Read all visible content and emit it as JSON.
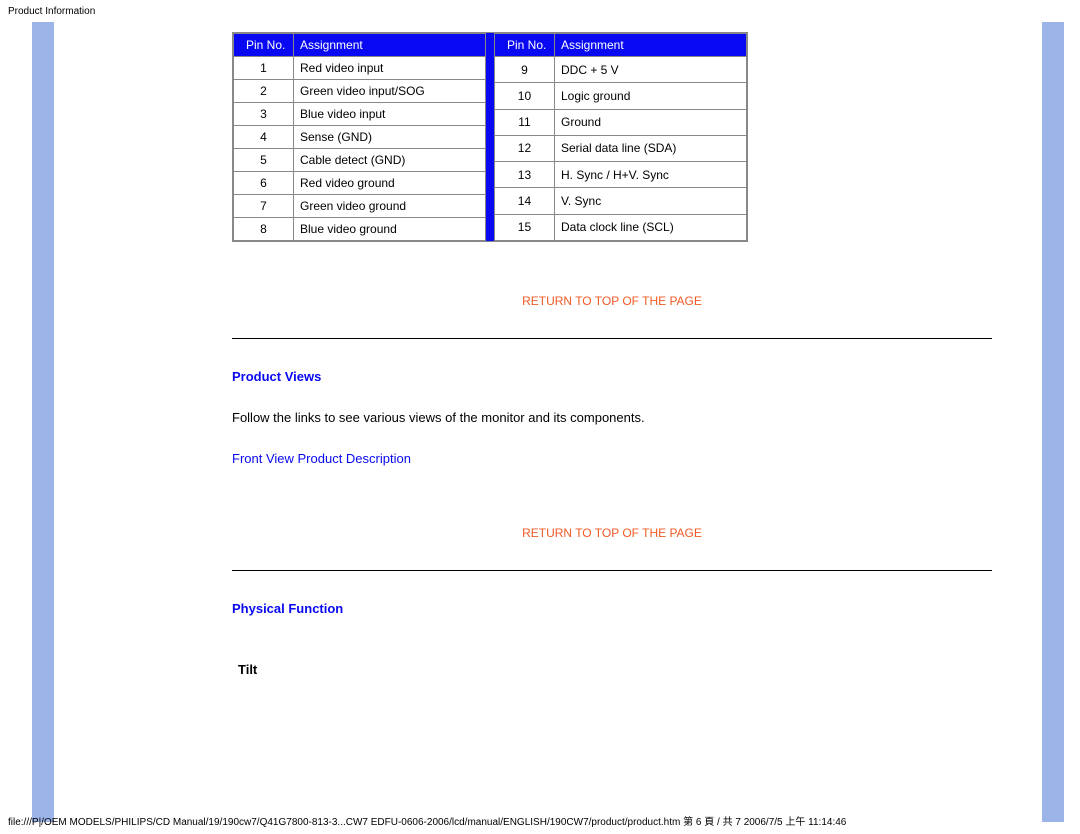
{
  "header_label": "Product Information",
  "table": {
    "headers": {
      "pin": "Pin No.",
      "assign": "Assignment"
    },
    "left": [
      {
        "pin": "1",
        "assign": "Red video input"
      },
      {
        "pin": "2",
        "assign": "Green video input/SOG"
      },
      {
        "pin": "3",
        "assign": "Blue video input"
      },
      {
        "pin": "4",
        "assign": "Sense (GND)"
      },
      {
        "pin": "5",
        "assign": "Cable detect (GND)"
      },
      {
        "pin": "6",
        "assign": "Red video ground"
      },
      {
        "pin": "7",
        "assign": "Green video ground"
      },
      {
        "pin": "8",
        "assign": "Blue video ground"
      }
    ],
    "right": [
      {
        "pin": "9",
        "assign": "DDC + 5 V"
      },
      {
        "pin": "10",
        "assign": "Logic ground"
      },
      {
        "pin": "11",
        "assign": "Ground"
      },
      {
        "pin": "12",
        "assign": "Serial data line (SDA)"
      },
      {
        "pin": "13",
        "assign": "H. Sync / H+V. Sync"
      },
      {
        "pin": "14",
        "assign": "V. Sync"
      },
      {
        "pin": "15",
        "assign": "Data clock line (SCL)"
      }
    ]
  },
  "return_link": "RETURN TO TOP OF THE PAGE",
  "sections": {
    "product_views": {
      "heading": "Product Views",
      "body": "Follow the links to see various views of the monitor and its components.",
      "front_link": "Front View Product Description"
    },
    "physical_function": {
      "heading": "Physical Function",
      "tilt": "Tilt"
    }
  },
  "footer": "file:///P|/OEM MODELS/PHILIPS/CD Manual/19/190cw7/Q41G7800-813-3...CW7 EDFU-0606-2006/lcd/manual/ENGLISH/190CW7/product/product.htm 第 6 頁 / 共 7 2006/7/5 上午 11:14:46"
}
